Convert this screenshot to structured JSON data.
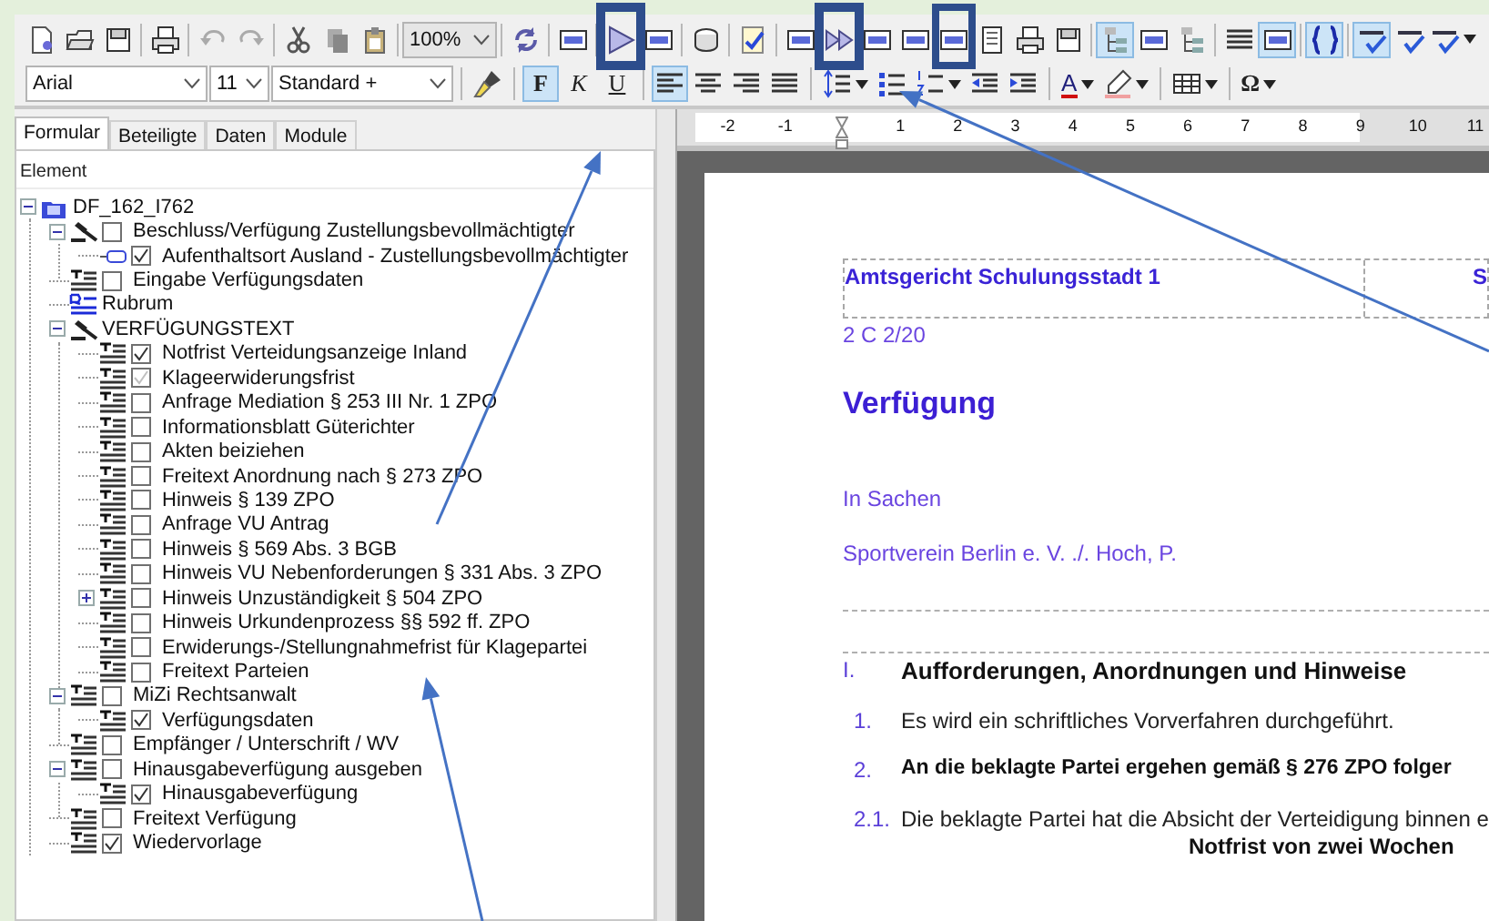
{
  "toolbar_1": [
    {
      "kind": "newdoc",
      "selected": false
    },
    {
      "kind": "folder",
      "selected": false
    },
    {
      "kind": "save",
      "selected": false
    },
    {
      "kind": "sep"
    },
    {
      "kind": "print",
      "selected": false
    },
    {
      "kind": "sep"
    },
    {
      "kind": "undo",
      "selected": false
    },
    {
      "kind": "redo",
      "selected": false
    },
    {
      "kind": "sep"
    },
    {
      "kind": "cut",
      "selected": false
    },
    {
      "kind": "copy",
      "selected": false
    },
    {
      "kind": "paste",
      "selected": false
    },
    {
      "kind": "sep"
    },
    {
      "kind": "combo",
      "value": "100%"
    },
    {
      "kind": "sep"
    },
    {
      "kind": "refresh",
      "selected": false
    },
    {
      "kind": "sep"
    },
    {
      "kind": "form",
      "selected": false
    },
    {
      "kind": "sep"
    },
    {
      "kind": "play",
      "selected": false
    },
    {
      "kind": "form",
      "selected": false
    },
    {
      "kind": "sep"
    },
    {
      "kind": "stack",
      "selected": false
    },
    {
      "kind": "sep"
    },
    {
      "kind": "checklist",
      "selected": false
    },
    {
      "kind": "sep"
    },
    {
      "kind": "form",
      "selected": false
    },
    {
      "kind": "fastforward",
      "selected": false
    },
    {
      "kind": "form",
      "selected": false
    },
    {
      "kind": "form",
      "selected": false
    },
    {
      "kind": "form",
      "selected": false
    },
    {
      "kind": "page",
      "selected": false
    },
    {
      "kind": "print",
      "selected": false
    },
    {
      "kind": "save",
      "selected": false
    },
    {
      "kind": "sep"
    },
    {
      "kind": "tree",
      "selected": true
    },
    {
      "kind": "form",
      "selected": false
    },
    {
      "kind": "tree",
      "selected": false
    },
    {
      "kind": "sep"
    },
    {
      "kind": "lines",
      "selected": false
    },
    {
      "kind": "form",
      "selected": true
    },
    {
      "kind": "sep"
    },
    {
      "kind": "braces",
      "selected": true
    },
    {
      "kind": "sep"
    },
    {
      "kind": "spell",
      "selected": true
    },
    {
      "kind": "spell",
      "selected": false
    },
    {
      "kind": "spell",
      "selected": false,
      "menu": true
    }
  ],
  "toolbar_2": [
    {
      "kind": "combo",
      "value": "Arial"
    },
    {
      "kind": "combo",
      "value": "11"
    },
    {
      "kind": "combo",
      "value": "Standard +"
    },
    {
      "kind": "sep"
    },
    {
      "kind": "brush",
      "selected": false
    },
    {
      "kind": "sep"
    },
    {
      "kind": "bold",
      "label": "F",
      "selected": true
    },
    {
      "kind": "italic",
      "label": "K",
      "selected": false
    },
    {
      "kind": "underline",
      "label": "U",
      "selected": false
    },
    {
      "kind": "sep"
    },
    {
      "kind": "align-left",
      "selected": true
    },
    {
      "kind": "align-center",
      "selected": false
    },
    {
      "kind": "align-right",
      "selected": false
    },
    {
      "kind": "justify",
      "selected": false
    },
    {
      "kind": "sep"
    },
    {
      "kind": "line-spacing",
      "selected": false,
      "menu": true
    },
    {
      "kind": "bullets",
      "selected": false
    },
    {
      "kind": "numbering",
      "selected": false,
      "menu": true
    },
    {
      "kind": "outdent",
      "selected": false
    },
    {
      "kind": "indent",
      "selected": false
    },
    {
      "kind": "sep"
    },
    {
      "kind": "font-color",
      "label": "A",
      "selected": false,
      "menu": true
    },
    {
      "kind": "pen",
      "selected": false,
      "menu": true
    },
    {
      "kind": "sep"
    },
    {
      "kind": "table",
      "selected": false,
      "menu": true
    },
    {
      "kind": "sep"
    },
    {
      "kind": "symbol",
      "label": "Ω",
      "selected": false,
      "menu": true
    }
  ],
  "tabs": [
    {
      "label": "Formular",
      "selected": true
    },
    {
      "label": "Beteiligte",
      "selected": false
    },
    {
      "label": "Daten",
      "selected": false
    },
    {
      "label": "Module",
      "selected": false
    }
  ],
  "tree_header": "Element",
  "tree": [
    {
      "label": "DF_162_I762",
      "kind": "folder",
      "expanded": true,
      "children": [
        {
          "label": "Beschluss/Verfügung Zustellungsbevollmächtigter",
          "kind": "gavel",
          "checked": false,
          "expanded": true,
          "children": [
            {
              "label": "Aufenthaltsort Ausland - Zustellungsbevollmächtigter",
              "kind": "field",
              "checked": true
            }
          ]
        },
        {
          "label": "Eingabe Verfügungsdaten",
          "kind": "text",
          "checked": false
        },
        {
          "label": "Rubrum",
          "kind": "rubrum"
        },
        {
          "label": "VERFÜGUNGSTEXT",
          "kind": "gavel",
          "expanded": true,
          "children": [
            {
              "label": "Notfrist  Verteidungsanzeige Inland",
              "kind": "text",
              "checked": true
            },
            {
              "label": "Klageerwiderungsfrist",
              "kind": "text",
              "checked": true,
              "disabled": true
            },
            {
              "label": "Anfrage Mediation § 253 III Nr. 1 ZPO",
              "kind": "text",
              "checked": false
            },
            {
              "label": "Informationsblatt Güterichter",
              "kind": "text",
              "checked": false
            },
            {
              "label": "Akten beiziehen",
              "kind": "text",
              "checked": false
            },
            {
              "label": "Freitext Anordnung nach § 273 ZPO",
              "kind": "text",
              "checked": false
            },
            {
              "label": "Hinweis § 139 ZPO",
              "kind": "text",
              "checked": false
            },
            {
              "label": "Anfrage VU Antrag",
              "kind": "text",
              "checked": false
            },
            {
              "label": "Hinweis § 569 Abs. 3 BGB",
              "kind": "text",
              "checked": false
            },
            {
              "label": "Hinweis VU Nebenforderungen § 331 Abs. 3 ZPO",
              "kind": "text",
              "checked": false
            },
            {
              "label": "Hinweis Unzuständigkeit § 504 ZPO",
              "kind": "text",
              "checked": false,
              "expanded": false
            },
            {
              "label": "Hinweis Urkundenprozess §§ 592 ff. ZPO",
              "kind": "text",
              "checked": false
            },
            {
              "label": "Erwiderungs-/Stellungnahmefrist für Klagepartei",
              "kind": "text",
              "checked": false
            },
            {
              "label": "Freitext Parteien",
              "kind": "text",
              "checked": false
            }
          ]
        },
        {
          "label": "MiZi Rechtsanwalt",
          "kind": "text",
          "checked": false,
          "expanded": true,
          "children": [
            {
              "label": "Verfügungsdaten",
              "kind": "text",
              "checked": true
            }
          ]
        },
        {
          "label": "Empfänger / Unterschrift / WV",
          "kind": "text",
          "checked": false
        },
        {
          "label": "Hinausgabeverfügung ausgeben",
          "kind": "text",
          "checked": false,
          "expanded": true,
          "children": [
            {
              "label": "Hinausgabeverfügung",
              "kind": "text",
              "checked": true
            }
          ]
        },
        {
          "label": "Freitext Verfügung",
          "kind": "text",
          "checked": false
        },
        {
          "label": "Wiedervorlage",
          "kind": "text",
          "checked": true
        }
      ]
    }
  ],
  "ruler": [
    {
      "kind": "number",
      "label": "-2"
    },
    {
      "kind": "number",
      "label": "-1"
    },
    {
      "kind": "indent"
    },
    {
      "kind": "number",
      "label": "1"
    },
    {
      "kind": "number",
      "label": "2"
    },
    {
      "kind": "number",
      "label": "3"
    },
    {
      "kind": "number",
      "label": "4"
    },
    {
      "kind": "number",
      "label": "5"
    },
    {
      "kind": "number",
      "label": "6"
    },
    {
      "kind": "number",
      "label": "7"
    },
    {
      "kind": "number",
      "label": "8"
    },
    {
      "kind": "number",
      "label": "9"
    },
    {
      "kind": "number",
      "label": "10"
    },
    {
      "kind": "number",
      "label": "11"
    }
  ],
  "document": {
    "header_cells": [
      "Amtsgericht Schulungsstadt 1",
      "S"
    ],
    "file_number": "2 C 2/20",
    "title": "Verfügung",
    "intro": "In Sachen",
    "parties": "Sportverein Berlin e. V. ./. Hoch, P.",
    "sections": [
      {
        "kind": "heading",
        "number": "I.",
        "text": "Aufforderungen, Anordnungen und Hinweise"
      },
      {
        "kind": "item",
        "number": "1.",
        "text": "Es wird ein schriftliches Vorverfahren durchgeführt."
      },
      {
        "kind": "bold-item",
        "number": "2.",
        "text": "An die beklagte Partei ergehen gemäß § 276 ZPO folger"
      },
      {
        "kind": "item",
        "number": "2.1.",
        "text": "Die beklagte Partei hat die Absicht der Verteidigung binnen e"
      }
    ],
    "note": "Notfrist von zwei Wochen"
  }
}
